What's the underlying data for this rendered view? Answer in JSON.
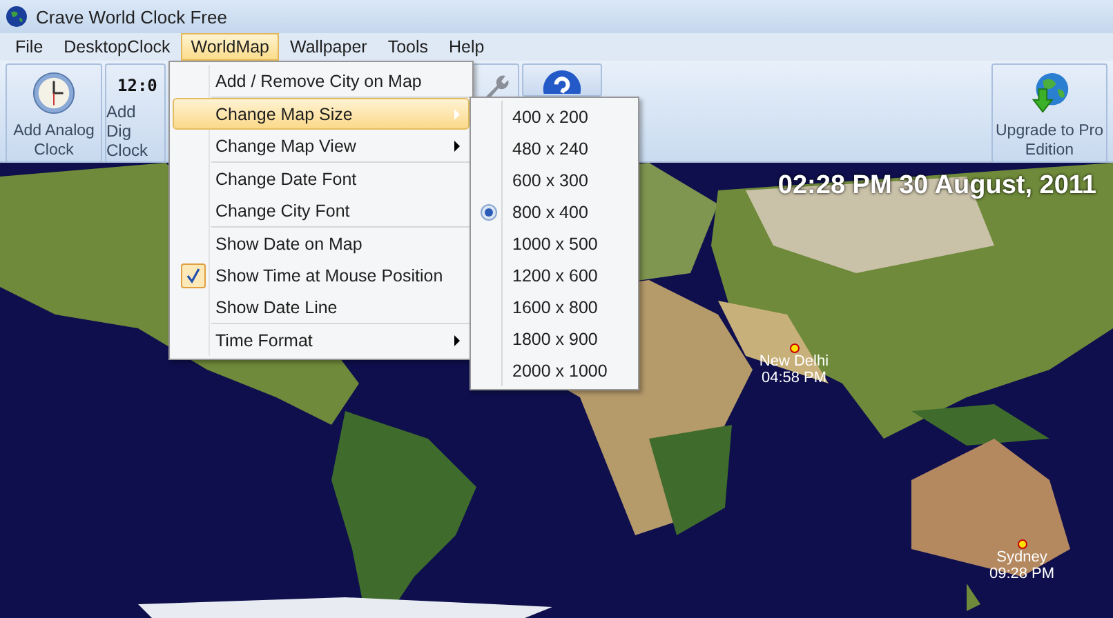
{
  "window": {
    "title": "Crave World Clock Free"
  },
  "menubar": [
    {
      "label": "File",
      "selected": false
    },
    {
      "label": "DesktopClock",
      "selected": false
    },
    {
      "label": "WorldMap",
      "selected": true
    },
    {
      "label": "Wallpaper",
      "selected": false
    },
    {
      "label": "Tools",
      "selected": false
    },
    {
      "label": "Help",
      "selected": false
    }
  ],
  "toolbar": {
    "analog_button": {
      "label": "Add Analog Clock"
    },
    "digital_button": {
      "display": "12:0",
      "lines": [
        "Add Dig",
        "Clock"
      ]
    },
    "upgrade_button": {
      "label": "Upgrade to Pro Edition"
    }
  },
  "map": {
    "kind": "picture",
    "datetime": "02:28 PM 30 August, 2011",
    "cities": [
      {
        "name": "New Delhi",
        "time": "04:58 PM"
      },
      {
        "name": "Sydney",
        "time": "09:28 PM"
      }
    ]
  },
  "worldmap_menu": [
    {
      "kind": "command",
      "label": "Add / Remove City on Map",
      "selected": false
    },
    {
      "kind": "separator"
    },
    {
      "kind": "submenu",
      "label": "Change Map Size",
      "selected": true
    },
    {
      "kind": "submenu",
      "label": "Change Map View",
      "selected": false
    },
    {
      "kind": "separator"
    },
    {
      "kind": "command",
      "label": "Change Date Font",
      "selected": false
    },
    {
      "kind": "command",
      "label": "Change City Font",
      "selected": false
    },
    {
      "kind": "separator"
    },
    {
      "kind": "check",
      "label": "Show Date on Map",
      "checked": false,
      "selected": false
    },
    {
      "kind": "check",
      "label": "Show Time at Mouse Position",
      "checked": true,
      "selected": false
    },
    {
      "kind": "check",
      "label": "Show Date Line",
      "checked": false,
      "selected": false
    },
    {
      "kind": "separator"
    },
    {
      "kind": "submenu",
      "label": "Time Format",
      "selected": false
    }
  ],
  "map_size_submenu": [
    {
      "label": "400 x 200",
      "selected": false
    },
    {
      "label": "480 x 240",
      "selected": false
    },
    {
      "label": "600 x 300",
      "selected": false
    },
    {
      "label": "800 x 400",
      "selected": true
    },
    {
      "label": "1000 x 500",
      "selected": false
    },
    {
      "label": "1200 x 600",
      "selected": false
    },
    {
      "label": "1600 x 800",
      "selected": false
    },
    {
      "label": "1800 x 900",
      "selected": false
    },
    {
      "label": "2000 x 1000",
      "selected": false
    }
  ]
}
